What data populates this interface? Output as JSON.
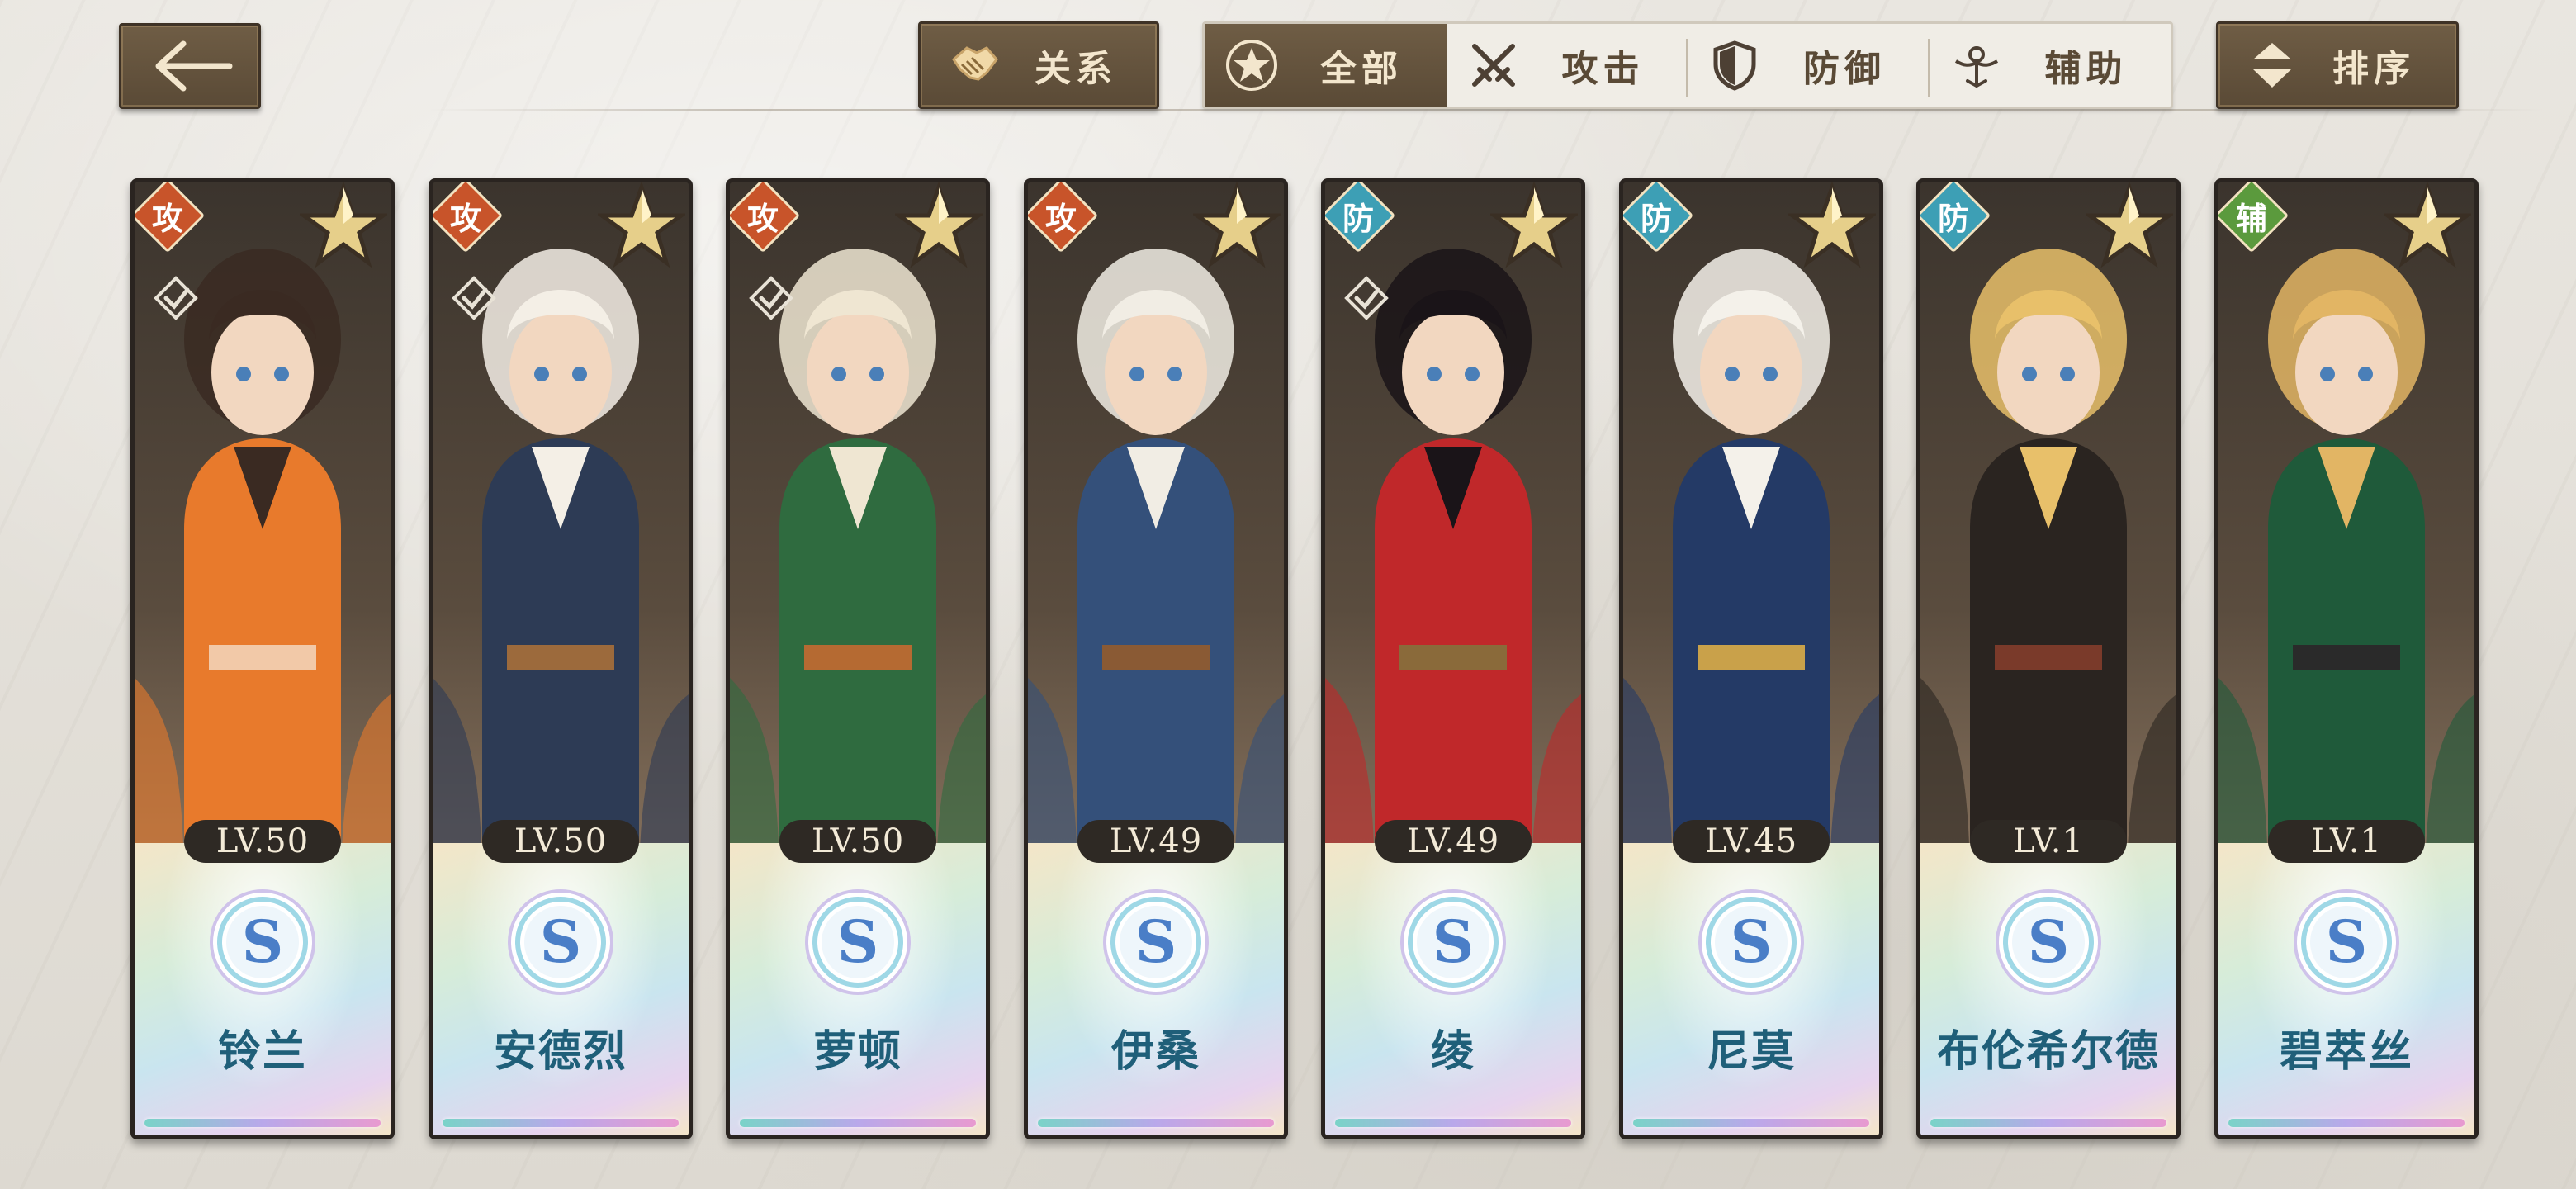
{
  "toolbar": {
    "relation_label": "关系",
    "sort_label": "排序",
    "filters": [
      {
        "label": "全部",
        "icon": "star-icon",
        "active": true
      },
      {
        "label": "攻击",
        "icon": "crossed-swords-icon",
        "active": false
      },
      {
        "label": "防御",
        "icon": "shield-icon",
        "active": false
      },
      {
        "label": "辅助",
        "icon": "support-icon",
        "active": false
      }
    ]
  },
  "colors": {
    "attack": "#c8542a",
    "defense": "#3d9fb5",
    "support": "#5b9a3d",
    "name_text": "#1f5f79",
    "button_dark": "#5a4a36"
  },
  "characters": [
    {
      "name": "铃兰",
      "level": "LV.50",
      "role": "攻",
      "role_type": "attack",
      "rank": "S",
      "linked": true,
      "art_palette": [
        "#e87a2c",
        "#3a2a22",
        "#f2c9a8"
      ]
    },
    {
      "name": "安德烈",
      "level": "LV.50",
      "role": "攻",
      "role_type": "attack",
      "rank": "S",
      "linked": true,
      "art_palette": [
        "#2d3b55",
        "#f4efe6",
        "#9c6a3c"
      ]
    },
    {
      "name": "萝顿",
      "level": "LV.50",
      "role": "攻",
      "role_type": "attack",
      "rank": "S",
      "linked": true,
      "art_palette": [
        "#2f6b3f",
        "#efe6d2",
        "#b56a32"
      ]
    },
    {
      "name": "伊桑",
      "level": "LV.49",
      "role": "攻",
      "role_type": "attack",
      "rank": "S",
      "linked": false,
      "art_palette": [
        "#34507a",
        "#f1ede4",
        "#8a5a34"
      ]
    },
    {
      "name": "绫",
      "level": "LV.49",
      "role": "防",
      "role_type": "defense",
      "rank": "S",
      "linked": true,
      "art_palette": [
        "#c0282a",
        "#1a1418",
        "#8a6a3a"
      ]
    },
    {
      "name": "尼莫",
      "level": "LV.45",
      "role": "防",
      "role_type": "defense",
      "rank": "S",
      "linked": false,
      "art_palette": [
        "#243a66",
        "#f4f1ea",
        "#c9a14a"
      ]
    },
    {
      "name": "布伦希尔德",
      "level": "LV.1",
      "role": "防",
      "role_type": "defense",
      "rank": "S",
      "linked": false,
      "art_palette": [
        "#2a2420",
        "#e8c06a",
        "#7a3a2a"
      ]
    },
    {
      "name": "碧萃丝",
      "level": "LV.1",
      "role": "辅",
      "role_type": "support",
      "rank": "S",
      "linked": false,
      "art_palette": [
        "#1f5a3a",
        "#e2b564",
        "#2a2a2a"
      ]
    }
  ]
}
